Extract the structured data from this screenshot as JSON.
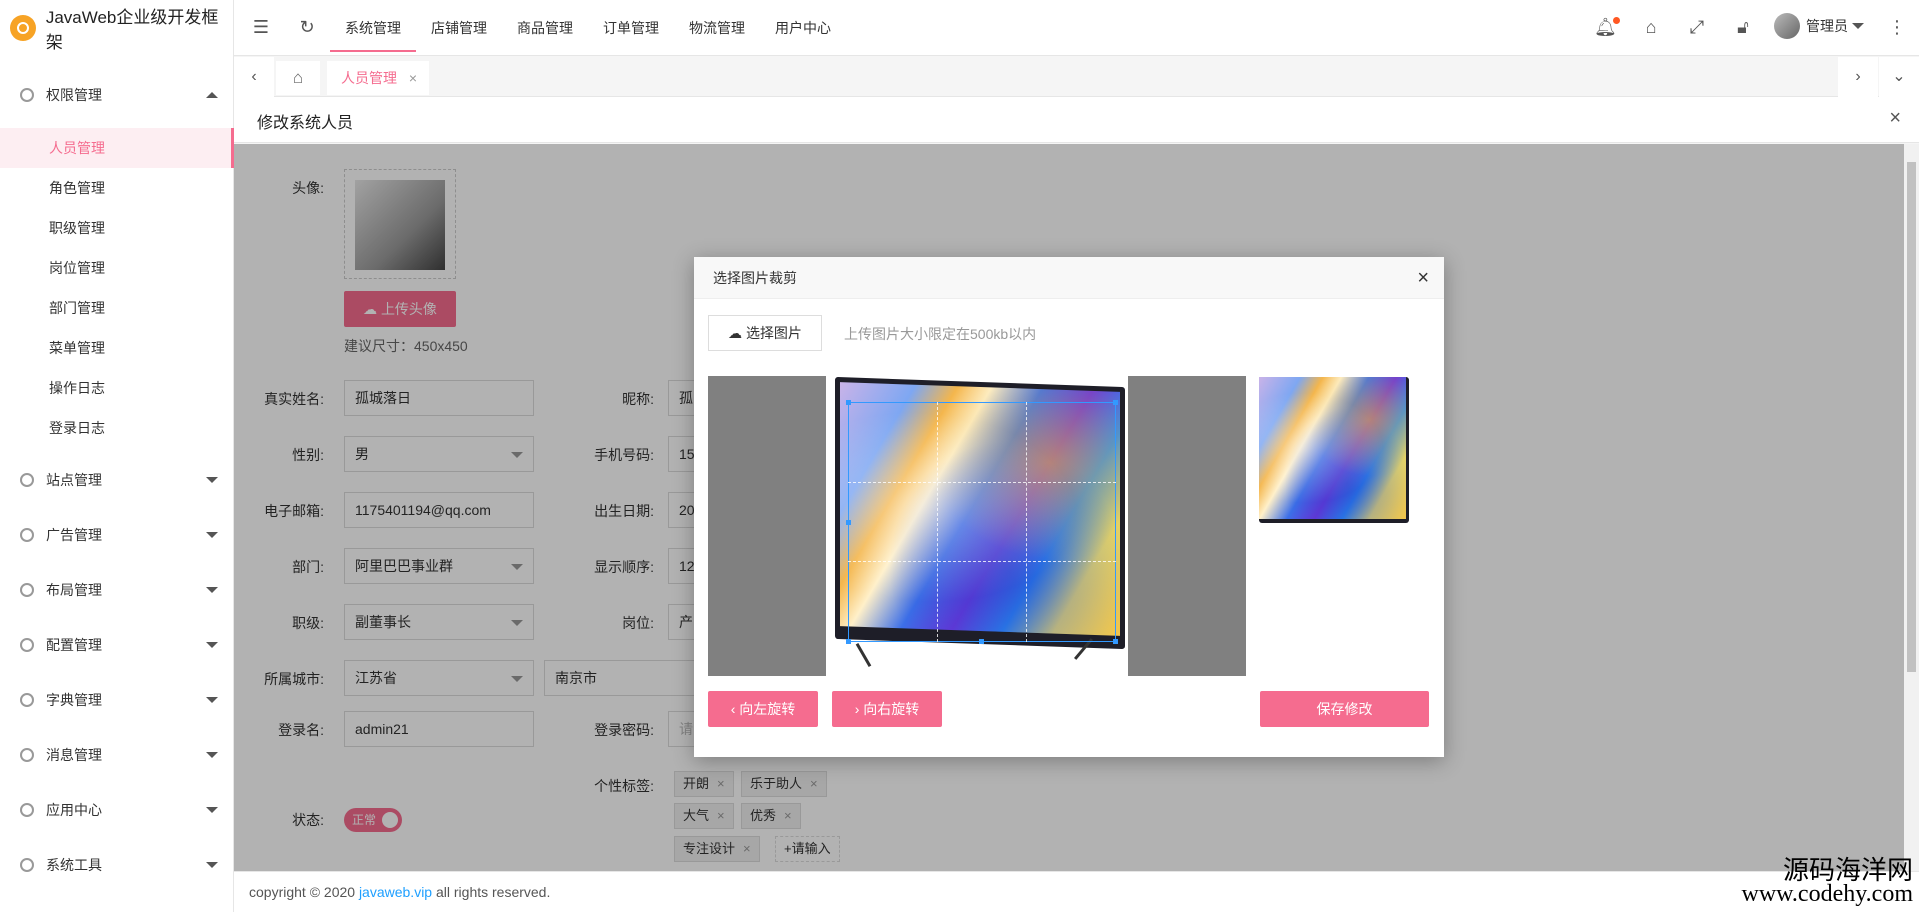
{
  "app": {
    "title": "JavaWeb企业级开发框架"
  },
  "sidebar": {
    "groups": [
      {
        "label": "权限管理",
        "expanded": true
      },
      {
        "label": "站点管理"
      },
      {
        "label": "广告管理"
      },
      {
        "label": "布局管理"
      },
      {
        "label": "配置管理"
      },
      {
        "label": "字典管理"
      },
      {
        "label": "消息管理"
      },
      {
        "label": "应用中心"
      },
      {
        "label": "系统工具"
      }
    ],
    "items": [
      "人员管理",
      "角色管理",
      "职级管理",
      "岗位管理",
      "部门管理",
      "菜单管理",
      "操作日志",
      "登录日志"
    ]
  },
  "topnav": {
    "menu": [
      "系统管理",
      "店铺管理",
      "商品管理",
      "订单管理",
      "物流管理",
      "用户中心"
    ],
    "user": "管理员"
  },
  "tabs": {
    "active": "人员管理"
  },
  "page": {
    "title": "修改系统人员"
  },
  "form": {
    "avatar_label": "头像:",
    "upload_button": "上传头像",
    "size_hint": "建议尺寸：450x450",
    "realname_label": "真实姓名:",
    "realname": "孤城落日",
    "nickname_label": "昵称:",
    "nickname": "孤",
    "gender_label": "性别:",
    "gender": "男",
    "mobile_label": "手机号码:",
    "mobile": "15",
    "email_label": "电子邮箱:",
    "email": "1175401194@qq.com",
    "birthday_label": "出生日期:",
    "birthday": "20",
    "dept_label": "部门:",
    "dept": "阿里巴巴事业群",
    "order_label": "显示顺序:",
    "order": "12",
    "rank_label": "职级:",
    "rank": "副董事长",
    "post_label": "岗位:",
    "post": "产",
    "city_label": "所属城市:",
    "province": "江苏省",
    "city": "南京市",
    "login_label": "登录名:",
    "login": "admin21",
    "password_label": "登录密码:",
    "password_placeholder": "请",
    "tags_label": "个性标签:",
    "tags": [
      "开朗",
      "乐于助人",
      "大气",
      "优秀",
      "专注设计"
    ],
    "tag_input": "+请输入",
    "status_label": "状态:",
    "status": "正常"
  },
  "modal": {
    "title": "选择图片裁剪",
    "choose_button": "选择图片",
    "hint": "上传图片大小限定在500kb以内",
    "rotate_left": "向左旋转",
    "rotate_right": "向右旋转",
    "save": "保存修改"
  },
  "footer": {
    "prefix": "copyright © 2020 ",
    "link": "javaweb.vip",
    "suffix": " all rights reserved."
  },
  "watermark": {
    "line1": "源码海洋网",
    "line2": "www.codehy.com"
  },
  "colors": {
    "accent": "#f56c8f",
    "link": "#1e9fff"
  }
}
